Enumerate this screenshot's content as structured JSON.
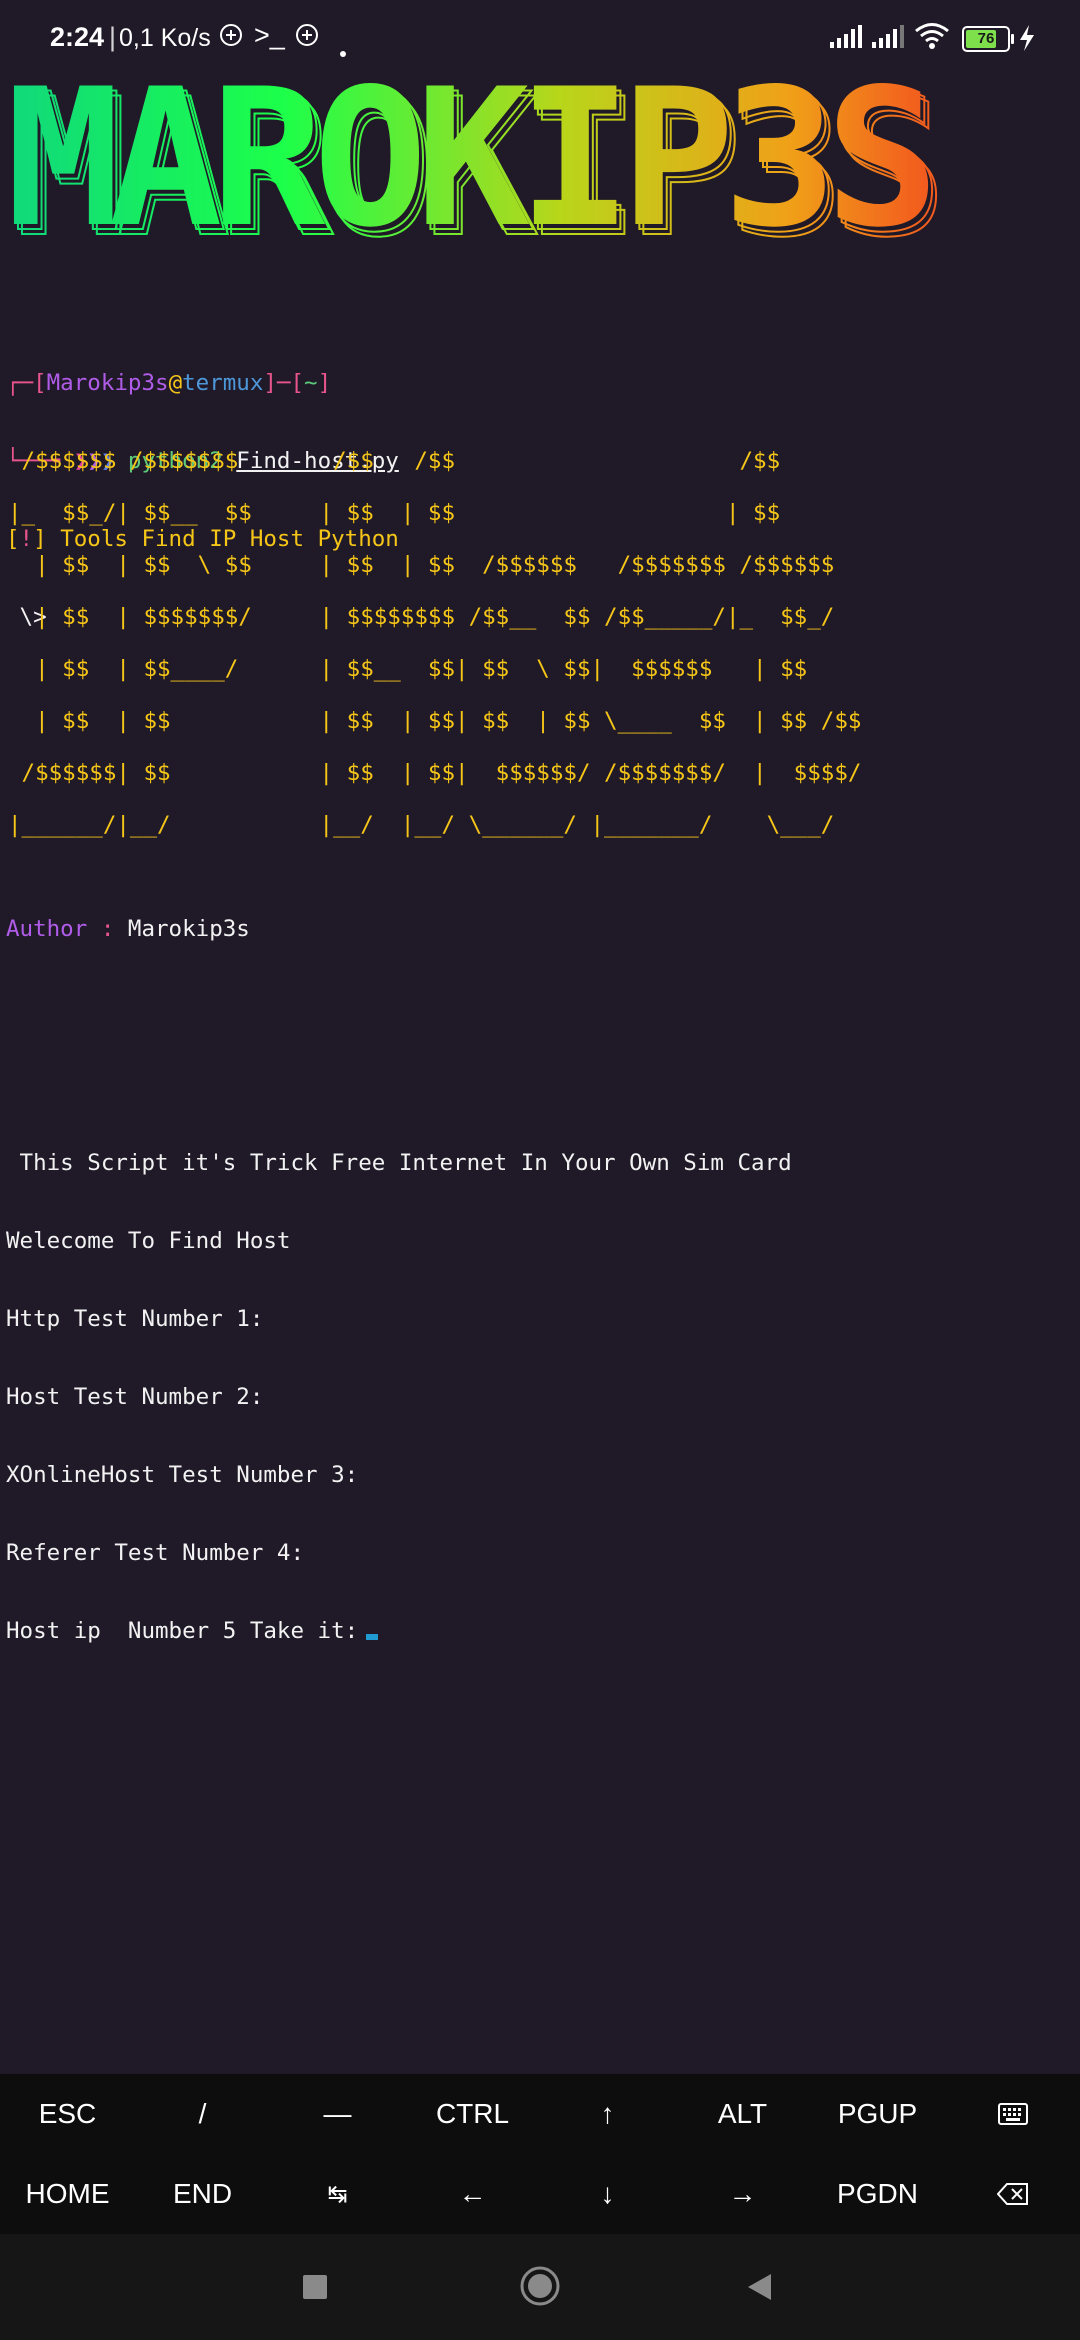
{
  "status_bar": {
    "time": "2:24",
    "net_speed": "0,1 Ko/s",
    "battery": "76",
    "battery_level": 0.76
  },
  "banner": {
    "text": "MAROKIP3S",
    "gradient": [
      "#10d87c",
      "#1cff4a",
      "#b8d61a",
      "#f0a018",
      "#f25a1e"
    ]
  },
  "prompt": {
    "user": "Marokip3s",
    "at": "@",
    "host": "termux",
    "dir": "~",
    "command": "python2",
    "file": "Find-host.py"
  },
  "tool_title": "Tools Find IP Host Python",
  "tool_subline": " \\>",
  "ascii_art": [
    " /$$$$$$ /$$$$$$$       /$$   /$$                     /$$",
    "|_  $$_/| $$__  $$     | $$  | $$                    | $$",
    "  | $$  | $$  \\ $$     | $$  | $$  /$$$$$$   /$$$$$$$ /$$$$$$",
    "  | $$  | $$$$$$$/     | $$$$$$$$ /$$__  $$ /$$_____/|_  $$_/",
    "  | $$  | $$____/      | $$__  $$| $$  \\ $$|  $$$$$$   | $$",
    "  | $$  | $$           | $$  | $$| $$  | $$ \\____  $$  | $$ /$$",
    " /$$$$$$| $$           | $$  | $$|  $$$$$$/ /$$$$$$$/  |  $$$$/",
    "|______/|__/           |__/  |__/ \\______/ |_______/    \\___/"
  ],
  "author": {
    "label": "Author",
    "colon": ":",
    "name": "Marokip3s"
  },
  "output_lines": [
    " This Script it's Trick Free Internet In Your Own Sim Card",
    "Welecome To Find Host",
    "Http Test Number 1:",
    "Host Test Number 2:",
    "XOnlineHost Test Number 3:",
    "Referer Test Number 4:",
    "Host ip  Number 5 Take it:"
  ],
  "extra_keys": {
    "row1": [
      "ESC",
      "/",
      "—",
      "CTRL",
      "↑",
      "ALT",
      "PGUP",
      "keyboard-icon"
    ],
    "row2": [
      "HOME",
      "END",
      "↹",
      "←",
      "↓",
      "→",
      "PGDN",
      "backspace-icon"
    ],
    "row1_labels": {
      "esc": "ESC",
      "slash": "/",
      "dash": "—",
      "ctrl": "CTRL",
      "up": "↑",
      "alt": "ALT",
      "pgup": "PGUP"
    },
    "row2_labels": {
      "home": "HOME",
      "end": "END",
      "tab": "↹",
      "left": "←",
      "down": "↓",
      "right": "→",
      "pgdn": "PGDN"
    }
  },
  "icons": [
    "plus-circle-icon",
    "terminal-icon",
    "signal-icon",
    "wifi-icon",
    "battery-icon",
    "charging-icon",
    "keyboard-icon",
    "backspace-icon",
    "recents-icon",
    "home-icon",
    "back-icon"
  ]
}
